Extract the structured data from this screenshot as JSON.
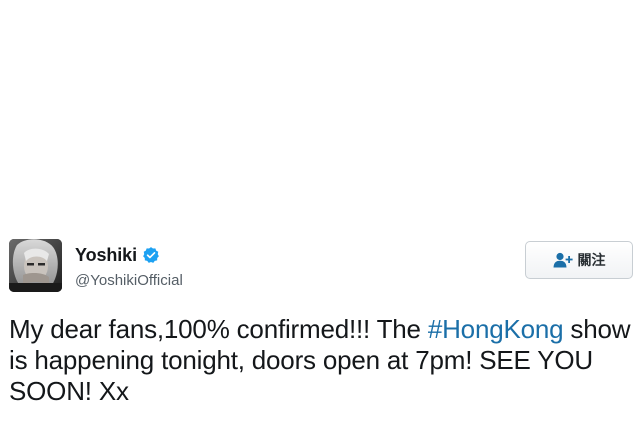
{
  "tweet": {
    "author": {
      "display_name": "Yoshiki",
      "handle": "@YoshikiOfficial",
      "verified": true,
      "avatar_icon": "profile-photo"
    },
    "follow_button": {
      "label": "關注",
      "icon": "add-user-icon"
    },
    "text": {
      "part1": "My dear fans,100% confirmed!!! The ",
      "hashtag": "#HongKong",
      "part2": " show is happening tonight, doors open at 7pm! SEE YOU SOON! Xx"
    },
    "colors": {
      "hashtag": "#1b6fa8",
      "verified_badge": "#1da1f2",
      "text": "#14171a",
      "handle": "#555e66"
    }
  }
}
